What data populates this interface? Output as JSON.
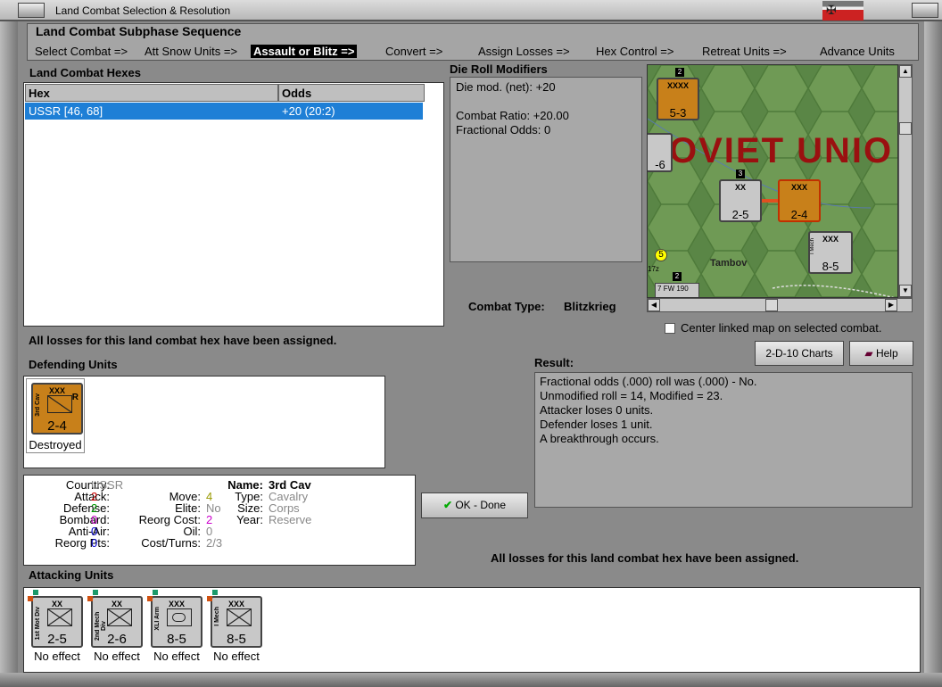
{
  "window": {
    "title": "Land Combat Selection & Resolution"
  },
  "sequence": {
    "title": "Land Combat Subphase Sequence",
    "steps": [
      "Select Combat =>",
      "Att Snow Units =>",
      "Assault or Blitz =>",
      "Convert =>",
      "Assign Losses =>",
      "Hex Control =>",
      "Retreat Units =>",
      "Advance Units"
    ],
    "active_index": 2
  },
  "hexes": {
    "title": "Land Combat Hexes",
    "headers": [
      "Hex",
      "Odds"
    ],
    "rows": [
      {
        "hex": "USSR [46, 68]",
        "odds": "+20 (20:2)"
      }
    ]
  },
  "modifiers": {
    "title": "Die Roll Modifiers",
    "net": "Die mod. (net): +20",
    "ratio": "Combat Ratio: +20.00",
    "fractional": "Fractional Odds: 0"
  },
  "map": {
    "label": "OVIET UNIO",
    "city": "Tambov",
    "counters": [
      {
        "size": "XXXX",
        "strength": "5-3",
        "stack": "2"
      },
      {
        "size": "XX",
        "strength": "2-5",
        "stack": "3"
      },
      {
        "size": "XXX",
        "strength": "2-4"
      },
      {
        "size": "XXX",
        "strength": "8-5",
        "name": "I Mech"
      },
      {
        "strength": "-6"
      }
    ],
    "stack_badge": "5",
    "air_unit": "FW 190",
    "air_stack": "2",
    "air_prefix": "7",
    "air_id": "17z"
  },
  "combat_type": {
    "label": "Combat Type:",
    "value": "Blitzkrieg"
  },
  "center_map": "Center linked map on selected combat.",
  "losses_msg": "All losses for this land combat hex have been assigned.",
  "buttons": {
    "charts": "2-D-10 Charts",
    "help": "Help",
    "ok": "OK - Done"
  },
  "defending": {
    "title": "Defending Units",
    "units": [
      {
        "name": "3rd Cav",
        "size": "XXX",
        "corner": "R",
        "strength": "2-4",
        "status": "Destroyed"
      }
    ]
  },
  "result": {
    "title": "Result:",
    "lines": [
      "Fractional odds (.000) roll was (.000)  - No.",
      "Unmodified roll = 14, Modified = 23.",
      "Attacker loses 0 units.",
      "Defender loses 1 unit.",
      "A breakthrough occurs."
    ]
  },
  "stats": {
    "country_l": "Country:",
    "country": "USSR",
    "attack_l": "Attack:",
    "attack": "2",
    "defense_l": "Defense:",
    "defense": "2",
    "bombard_l": "Bombard:",
    "bombard": "0",
    "antiair_l": "Anti-Air:",
    "antiair": "0",
    "reorgpts_l": "Reorg Pts:",
    "reorgpts": "0",
    "move_l": "Move:",
    "move": "4",
    "elite_l": "Elite:",
    "elite": "No",
    "reorgcost_l": "Reorg Cost:",
    "reorgcost": "2",
    "oil_l": "Oil:",
    "oil": "0",
    "costturns_l": "Cost/Turns:",
    "costturns": "2/3",
    "name_l": "Name:",
    "name": "3rd Cav",
    "type_l": "Type:",
    "type": "Cavalry",
    "size_l": "Size:",
    "size": "Corps",
    "year_l": "Year:",
    "year": "Reserve"
  },
  "attacking": {
    "title": "Attacking Units",
    "units": [
      {
        "name": "1st Mot Div",
        "size": "XX",
        "strength": "2-5",
        "status": "No effect"
      },
      {
        "name": "2nd Mech Div",
        "size": "XX",
        "strength": "2-6",
        "status": "No effect"
      },
      {
        "name": "XLI Arm",
        "size": "XXX",
        "strength": "8-5",
        "status": "No effect"
      },
      {
        "name": "I Mech",
        "size": "XXX",
        "strength": "8-5",
        "status": "No effect"
      }
    ]
  },
  "colors": {
    "selection": "#1e7fd6",
    "axis_counter": "#c8c8c8",
    "soviet_counter": "#c8801a",
    "map_label": "#9a1010",
    "attack": "#cc0000",
    "defense": "#009900",
    "bombard": "#cc00cc",
    "antiair": "#0000cc",
    "move": "#999900"
  }
}
